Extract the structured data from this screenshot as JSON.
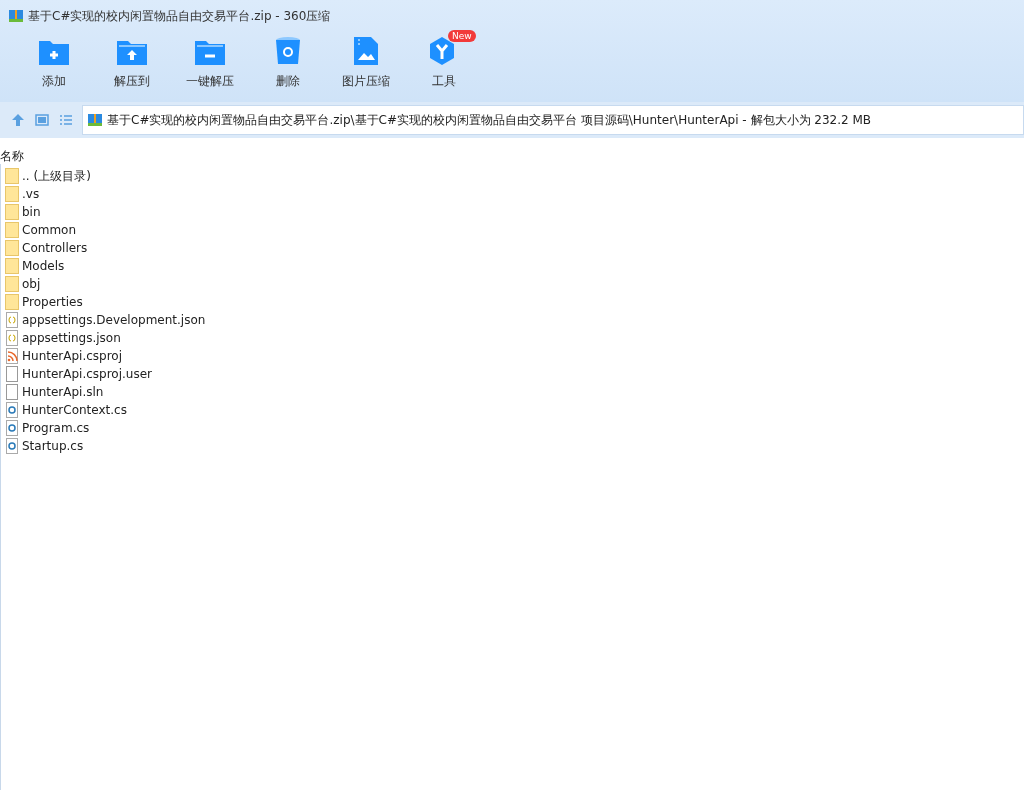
{
  "window": {
    "title": "基于C#实现的校内闲置物品自由交易平台.zip - 360压缩"
  },
  "toolbar": [
    {
      "kind": "add",
      "label": "添加"
    },
    {
      "kind": "extract",
      "label": "解压到"
    },
    {
      "kind": "oneclick",
      "label": "一键解压"
    },
    {
      "kind": "delete",
      "label": "删除"
    },
    {
      "kind": "image",
      "label": "图片压缩"
    },
    {
      "kind": "tools",
      "label": "工具",
      "badge": "New"
    }
  ],
  "address": {
    "path": "基于C#实现的校内闲置物品自由交易平台.zip\\基于C#实现的校内闲置物品自由交易平台 项目源码\\Hunter\\HunterApi - 解包大小为 232.2 MB"
  },
  "table": {
    "columns": [
      "名称"
    ],
    "rows": [
      {
        "kind": "folder",
        "name": ".. (上级目录)"
      },
      {
        "kind": "folder",
        "name": ".vs"
      },
      {
        "kind": "folder",
        "name": "bin"
      },
      {
        "kind": "folder",
        "name": "Common"
      },
      {
        "kind": "folder",
        "name": "Controllers"
      },
      {
        "kind": "folder",
        "name": "Models"
      },
      {
        "kind": "folder",
        "name": "obj"
      },
      {
        "kind": "folder",
        "name": "Properties"
      },
      {
        "kind": "json",
        "name": "appsettings.Development.json"
      },
      {
        "kind": "json",
        "name": "appsettings.json"
      },
      {
        "kind": "project",
        "name": "HunterApi.csproj"
      },
      {
        "kind": "file",
        "name": "HunterApi.csproj.user"
      },
      {
        "kind": "file",
        "name": "HunterApi.sln"
      },
      {
        "kind": "cs",
        "name": "HunterContext.cs"
      },
      {
        "kind": "cs",
        "name": "Program.cs"
      },
      {
        "kind": "cs",
        "name": "Startup.cs"
      }
    ]
  }
}
